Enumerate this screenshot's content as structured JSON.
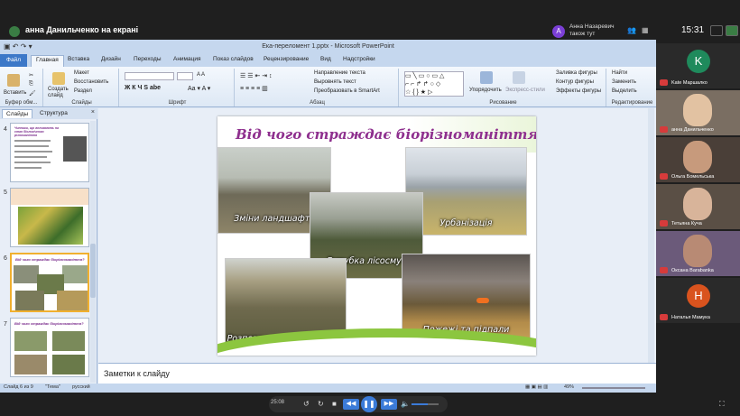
{
  "conference": {
    "title": "анна Данильченко на екрані",
    "presenter_initial": "А",
    "presenter_name_line1": "Анна Назаревич",
    "presenter_name_line2": "також тут",
    "time": "15:31"
  },
  "ppt": {
    "window_title": "Ека-переломент 1.pptx - Microsoft PowerPoint",
    "tabs": [
      "Файл",
      "Главная",
      "Вставка",
      "Дизайн",
      "Переходы",
      "Анимация",
      "Показ слайдов",
      "Рецензирование",
      "Вид",
      "Надстройки"
    ],
    "ribbon": {
      "paste": "Вставить",
      "create_slide": "Создать слайд",
      "layout": "Макет",
      "reset": "Восстановить",
      "section": "Раздел",
      "text_direction": "Направление текста",
      "align_text": "Выровнять текст",
      "smartart": "Преобразовать в SmartArt",
      "arrange": "Упорядочить",
      "quick_styles": "Экспресс-стили",
      "shape_fill": "Заливка фигуры",
      "shape_outline": "Контур фигуры",
      "shape_effects": "Эффекты фигуры",
      "find": "Найти",
      "replace": "Заменить",
      "select": "Выделить",
      "groups": [
        "Буфер обм...",
        "Слайды",
        "Шрифт",
        "Абзац",
        "Рисование",
        "Редактирование"
      ]
    },
    "left_panel": {
      "tab_slides": "Слайды",
      "tab_outline": "Структура",
      "close": "×",
      "thumb_numbers": [
        "4",
        "5",
        "6",
        "7"
      ],
      "thumb_titles": [
        "Чинники, що впливають на стан біологічного різноманіття",
        "",
        "Від чого страждає біорізноманіття?",
        "Від чого страждає біорізноманіття?"
      ]
    },
    "slide": {
      "title": "Від чого страждає біорізноманіття?",
      "captions": [
        "Зміни ландшафту",
        "Урбанізація",
        "Вирубка лісосмуг",
        "Розповсюдження бур'янів",
        "Пожежі та підпали"
      ]
    },
    "notes_placeholder": "Заметки к слайду",
    "status": {
      "slide_of": "Слайд 6 из 9",
      "theme": "\"Тема\"",
      "language": "русский",
      "zoom": "49%"
    }
  },
  "participants": [
    {
      "name": "Kate Маршалко",
      "initial": "K",
      "color": "#1f8a5c",
      "type": "avatar"
    },
    {
      "name": "анна Данильченко",
      "type": "video"
    },
    {
      "name": "Ольга Бомельська",
      "type": "video"
    },
    {
      "name": "Тетьяна Куча",
      "type": "video"
    },
    {
      "name": "Оксана Barabanka",
      "type": "video"
    },
    {
      "name": "Наталья Мамука",
      "initial": "Н",
      "color": "#d9531e",
      "type": "avatar"
    }
  ],
  "player": {
    "time": "25:08"
  }
}
